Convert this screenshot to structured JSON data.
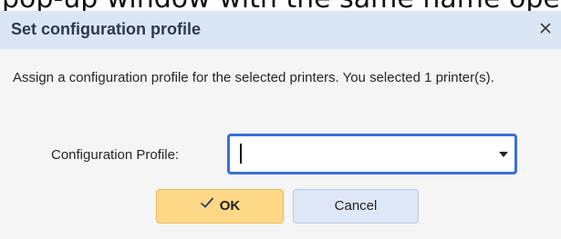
{
  "background_caption": "pop-up window with the same name opens.",
  "dialog": {
    "title": "Set configuration profile",
    "close_icon": "close-icon",
    "message": "Assign a configuration profile for the selected printers. You selected 1 printer(s).",
    "field_label": "Configuration Profile:",
    "profile_value": "",
    "dropdown_icon": "chevron-down-icon",
    "ok_label": "OK",
    "ok_icon": "checkmark-icon",
    "cancel_label": "Cancel"
  },
  "colors": {
    "titlebar": "#dbe6f4",
    "ok_button": "#fdd886",
    "cancel_button": "#dde7f5",
    "focus_border": "#3b6fd6"
  }
}
